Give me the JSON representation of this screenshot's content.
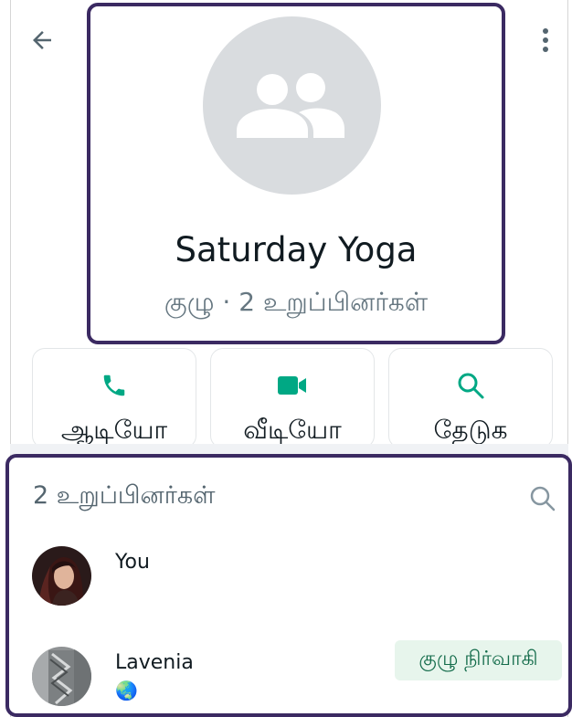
{
  "header": {
    "group_name": "Saturday Yoga",
    "subtitle": "குழு · 2 உறுப்பினர்கள்",
    "avatar_icon": "group-icon",
    "back_icon": "arrow-left-icon",
    "menu_icon": "more-vertical-icon"
  },
  "actions": [
    {
      "label": "ஆடியோ",
      "icon": "phone-icon",
      "color": "#00a884"
    },
    {
      "label": "வீடியோ",
      "icon": "video-icon",
      "color": "#00a884"
    },
    {
      "label": "தேடுக",
      "icon": "search-icon",
      "color": "#00a884"
    }
  ],
  "members": {
    "title": "2 உறுப்பினர்கள்",
    "search_icon": "search-icon",
    "list": [
      {
        "name": "You",
        "status": "",
        "badge": ""
      },
      {
        "name": "Lavenia",
        "status": "🌏",
        "badge": "குழு நிர்வாகி"
      }
    ]
  },
  "colors": {
    "accent": "#00a884",
    "highlight_border": "#3b2a62",
    "badge_bg": "#e7f5ec",
    "badge_text": "#146c4b",
    "secondary_text": "#667781"
  }
}
